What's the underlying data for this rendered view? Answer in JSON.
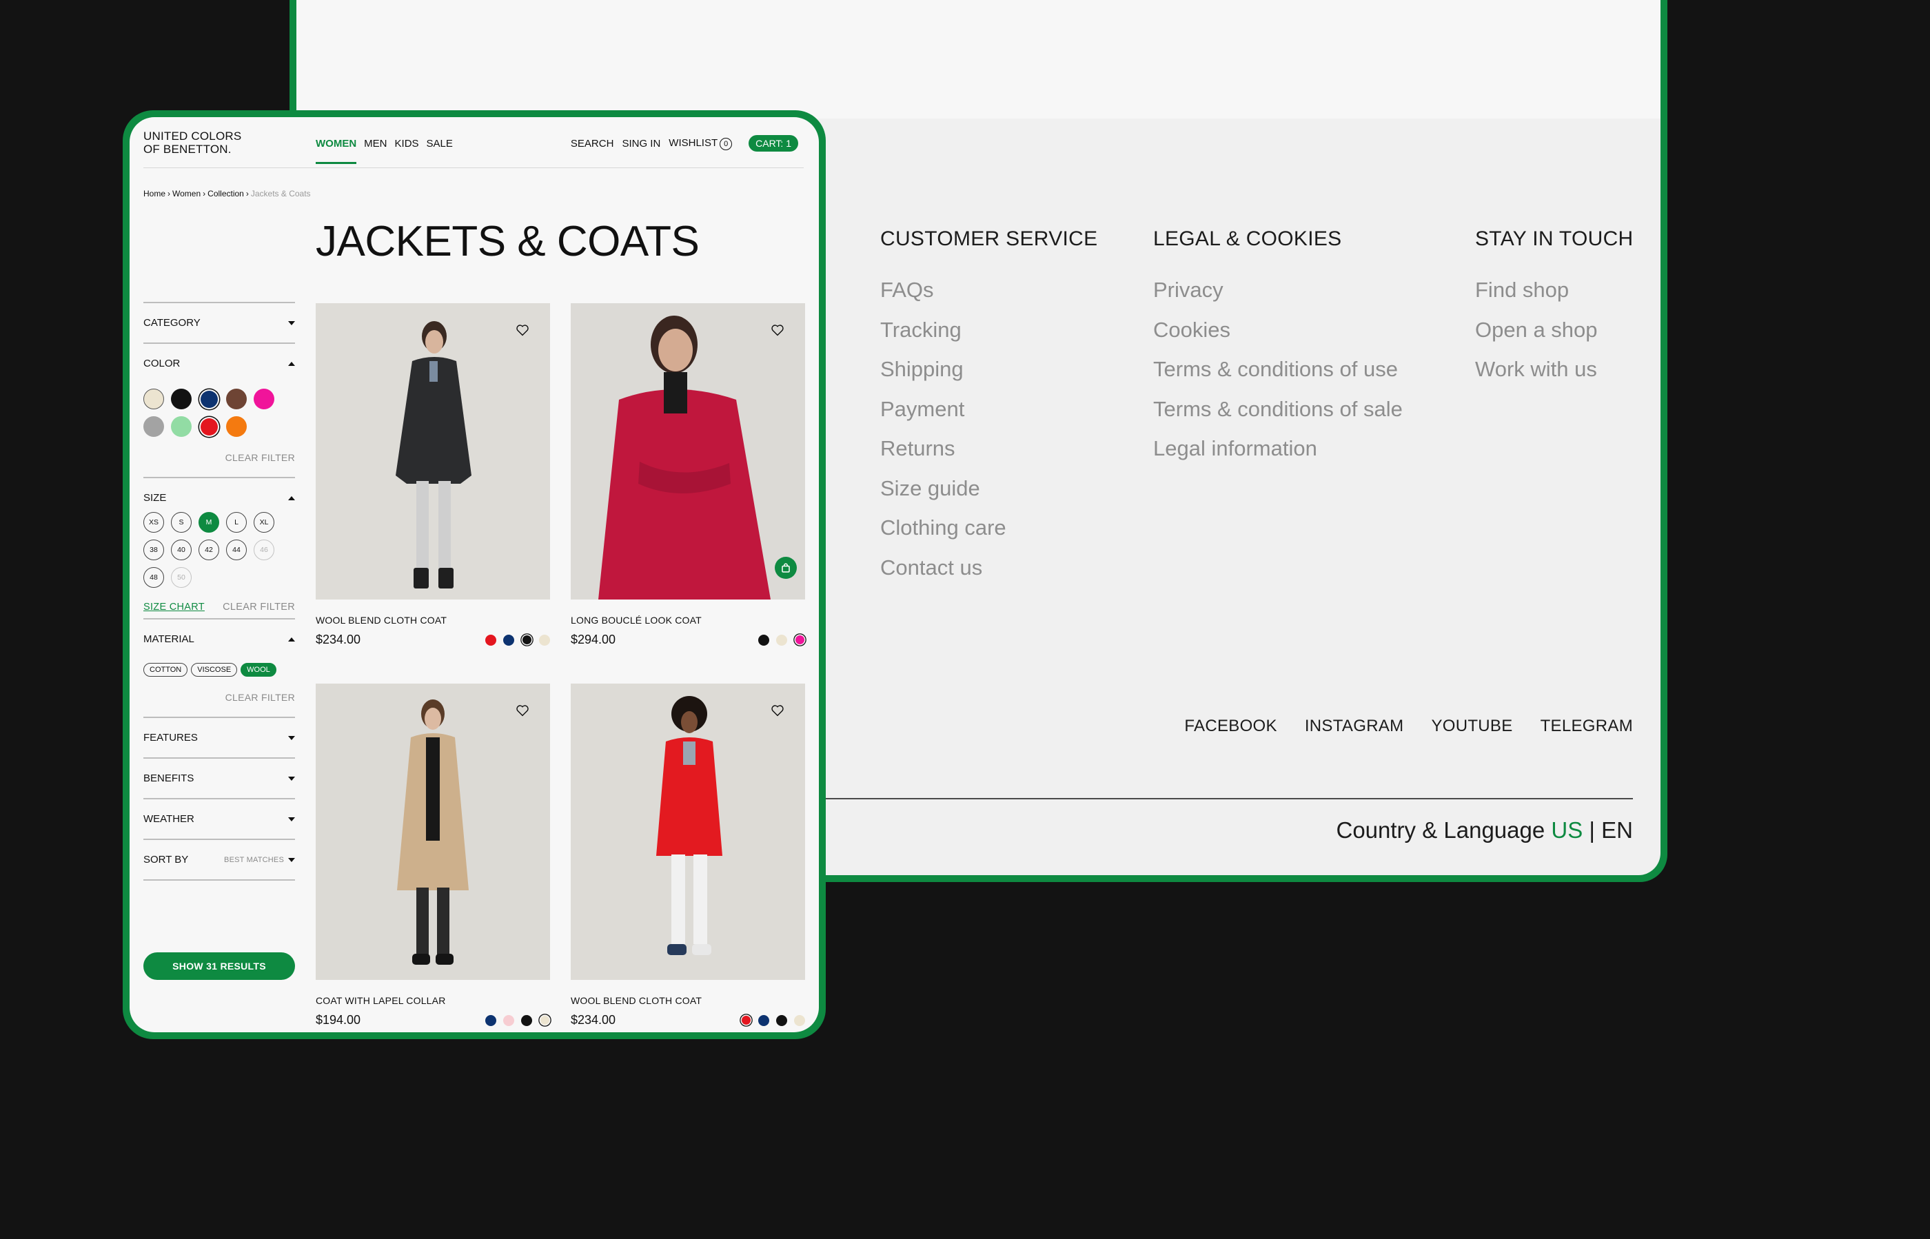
{
  "footer": {
    "customer_service": {
      "heading": "CUSTOMER SERVICE",
      "links": [
        "FAQs",
        "Tracking",
        "Shipping",
        "Payment",
        "Returns",
        "Size guide",
        "Clothing care",
        "Contact us"
      ]
    },
    "legal": {
      "heading": "LEGAL & COOKIES",
      "links": [
        "Privacy",
        "Cookies",
        "Terms & conditions of use",
        "Terms & conditions of sale",
        "Legal information"
      ]
    },
    "touch": {
      "heading": "STAY IN TOUCH",
      "links": [
        "Find shop",
        "Open a shop",
        "Work with us"
      ]
    },
    "socials": [
      "FACEBOOK",
      "INSTAGRAM",
      "YOUTUBE",
      "TELEGRAM"
    ],
    "country_label": "Country & Language",
    "country": "US",
    "separator": "|",
    "language": "EN"
  },
  "header": {
    "logo_line1": "UNITED COLORS",
    "logo_line2": "OF BENETTON.",
    "nav": [
      "WOMEN",
      "MEN",
      "KIDS",
      "SALE"
    ],
    "search": "SEARCH",
    "signin": "SING IN",
    "wishlist": "WISHLIST",
    "wishlist_count": "0",
    "cart": "CART: 1"
  },
  "breadcrumb": [
    "Home",
    "Women",
    "Collection",
    "Jackets & Coats"
  ],
  "page_title": "JACKETS & COATS",
  "filters": {
    "category": "CATEGORY",
    "color": "COLOR",
    "colors": [
      "#ece4d0",
      "#121212",
      "#0d3370",
      "#6e4434",
      "#f0149a",
      "#a3a3a3",
      "#92dca4",
      "#e4161f",
      "#f47a10"
    ],
    "selected_colors": [
      2,
      7
    ],
    "clear": "CLEAR FILTER",
    "size": "SIZE",
    "sizes": [
      "XS",
      "S",
      "M",
      "L",
      "XL",
      "38",
      "40",
      "42",
      "44",
      "46",
      "48",
      "50"
    ],
    "size_selected": "M",
    "size_unavailable": [
      "46",
      "50"
    ],
    "size_chart": "SIZE CHART",
    "material": "MATERIAL",
    "materials": [
      "COTTON",
      "VISCOSE",
      "WOOL"
    ],
    "material_selected": "WOOL",
    "features": "FEATURES",
    "benefits": "BENEFITS",
    "weather": "WEATHER",
    "sort_by": "SORT BY",
    "sort_value": "BEST MATCHES",
    "show_results": "SHOW 31 RESULTS"
  },
  "products": [
    {
      "name": "WOOL BLEND CLOTH COAT",
      "price": "$234.00",
      "colors": [
        "#e4161f",
        "#0d3370",
        "#121212",
        "#ece4d0"
      ],
      "selected_color": 2
    },
    {
      "name": "LONG BOUCLÉ LOOK COAT",
      "price": "$294.00",
      "colors": [
        "#121212",
        "#ece4d0",
        "#f0149a"
      ],
      "selected_color": 2
    },
    {
      "name": "COAT WITH LAPEL COLLAR",
      "price": "$194.00",
      "colors": [
        "#0d3370",
        "#f7cdd2",
        "#121212",
        "#ece4d0"
      ],
      "selected_color": 3
    },
    {
      "name": "WOOL BLEND CLOTH COAT",
      "price": "$234.00",
      "colors": [
        "#e4161f",
        "#0d3370",
        "#121212",
        "#ece4d0"
      ],
      "selected_color": 0
    }
  ],
  "accent": "#0e8a41"
}
